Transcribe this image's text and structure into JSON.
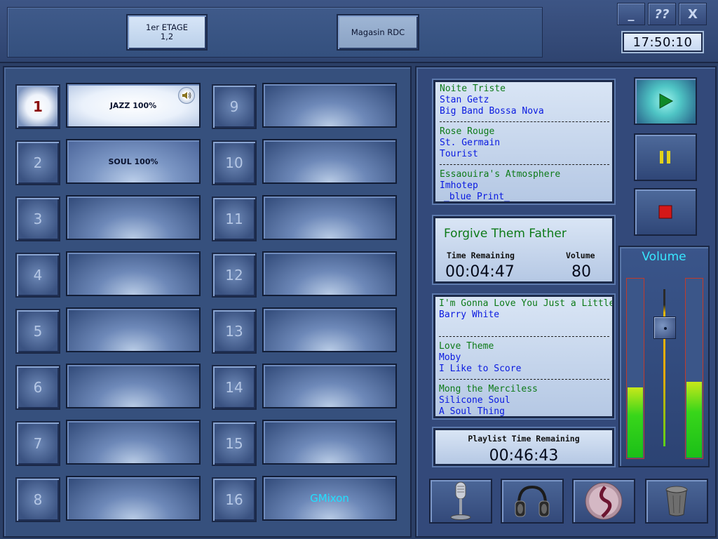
{
  "zones": [
    {
      "line1": "1er ETAGE",
      "line2": "1,2"
    },
    {
      "line1": "Magasin RDC",
      "line2": ""
    }
  ],
  "window_buttons": {
    "minimize": "_",
    "help": "??",
    "close": "X"
  },
  "clock": "17:50:10",
  "playlists": [
    {
      "num": "1",
      "label": "JAZZ 100%"
    },
    {
      "num": "2",
      "label": "SOUL 100%"
    },
    {
      "num": "3",
      "label": ""
    },
    {
      "num": "4",
      "label": ""
    },
    {
      "num": "5",
      "label": ""
    },
    {
      "num": "6",
      "label": ""
    },
    {
      "num": "7",
      "label": ""
    },
    {
      "num": "8",
      "label": ""
    },
    {
      "num": "9",
      "label": ""
    },
    {
      "num": "10",
      "label": ""
    },
    {
      "num": "11",
      "label": ""
    },
    {
      "num": "12",
      "label": ""
    },
    {
      "num": "13",
      "label": ""
    },
    {
      "num": "14",
      "label": ""
    },
    {
      "num": "15",
      "label": ""
    },
    {
      "num": "16",
      "label": "GMixon"
    }
  ],
  "previous_tracks": [
    {
      "title": "Noite Triste",
      "artist": "Stan Getz",
      "album": "Big Band Bossa Nova"
    },
    {
      "title": "Rose Rouge",
      "artist": "St. Germain",
      "album": "Tourist"
    },
    {
      "title": "Essaouira's Atmosphere",
      "artist": "Imhotep",
      "album": "_blue Print_"
    }
  ],
  "now_playing": {
    "title": "Forgive Them Father",
    "time_remaining_label": "Time Remaining",
    "time_remaining": "00:04:47",
    "volume_label": "Volume",
    "volume": "80"
  },
  "next_tracks": [
    {
      "title": "I'm Gonna Love You Just a Little More Baby",
      "artist": "Barry White",
      "album": ""
    },
    {
      "title": "Love Theme",
      "artist": "Moby",
      "album": "I Like to Score"
    },
    {
      "title": "Mong the Merciless",
      "artist": "Silicone Soul",
      "album": "A Soul Thing"
    }
  ],
  "playlist_time": {
    "label": "Playlist Time Remaining",
    "value": "00:46:43"
  },
  "volume_panel": {
    "label": "Volume",
    "level": 0.8,
    "meter_left": 0.39,
    "meter_right": 0.42
  },
  "colors": {
    "title_green": "#0d7a18",
    "artist_blue": "#0a1ae0",
    "gmix_cyan": "#20e0ff",
    "active_num": "#8a0a0a"
  },
  "tools": [
    "microphone-icon",
    "headphones-icon",
    "crystal-ball-icon",
    "trash-icon"
  ]
}
